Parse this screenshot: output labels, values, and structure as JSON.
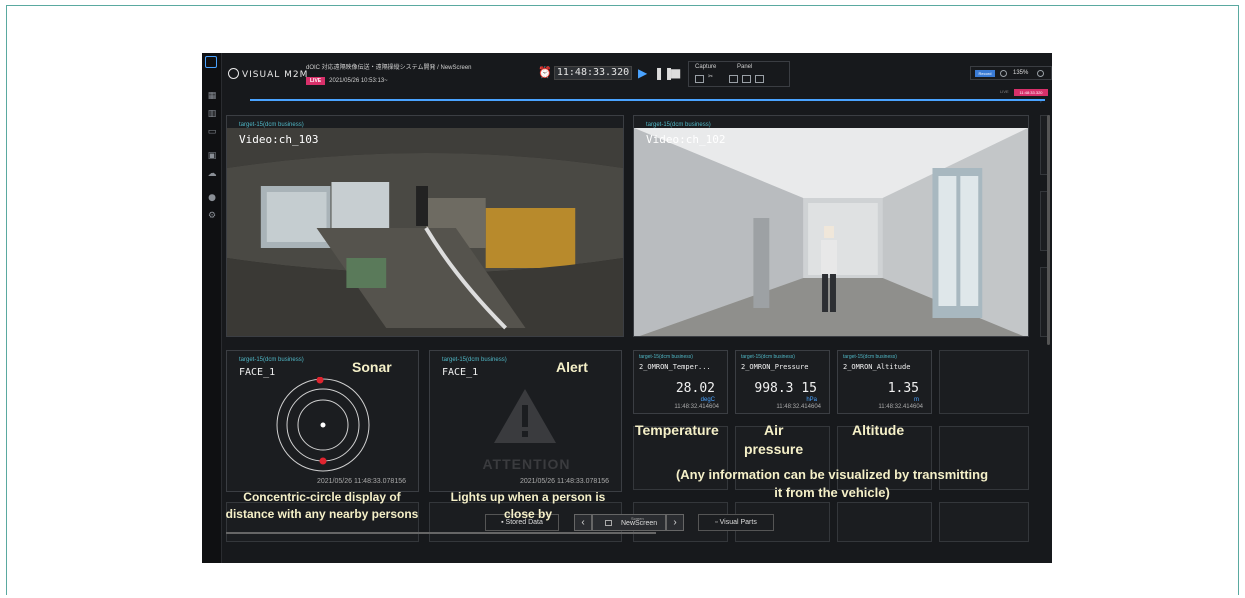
{
  "topbar": {
    "logo_text": "VISUAL M2M",
    "project_path": "dOIC 対応遠隔映像伝送・遠隔操縦システム開発 / NewScreen",
    "live_badge": "LIVE",
    "live_time": "2021/05/26 10:53:13~",
    "timecode": "11:48:33.320",
    "capture_label": "Capture",
    "panel_label": "Panel",
    "record_badge": "Record",
    "zoom": "135%",
    "timeline_badge": "11:48:33.320"
  },
  "videos": [
    {
      "target": "target-15(dcm business)",
      "title": "Video:ch_103"
    },
    {
      "target": "target-15(dcm business)",
      "title": "Video:ch_102"
    }
  ],
  "sonar_panel": {
    "target": "target-15(dcm business)",
    "title": "FACE_1",
    "timestamp": "2021/05/26 11:48:33.078156"
  },
  "alert_panel": {
    "target": "target-15(dcm business)",
    "title": "FACE_1",
    "attention": "ATTENTION",
    "timestamp": "2021/05/26 11:48:33.078156"
  },
  "sensors": [
    {
      "target": "target-15(dcm business)",
      "title": "2_OMRON_Temper...",
      "value": "28.02",
      "unit": "degC",
      "timestamp": "11:48:32.414604"
    },
    {
      "target": "target-15(dcm business)",
      "title": "2_OMRON_Pressure",
      "value": "998.3 15",
      "unit": "hPa",
      "timestamp": "11:48:32.414604"
    },
    {
      "target": "target-15(dcm business)",
      "title": "2_OMRON_Altitude",
      "value": "1.35",
      "unit": "m",
      "timestamp": "11:48:32.414604"
    }
  ],
  "bottombar": {
    "stored_data": "Stored Data",
    "screen_small": "Screen",
    "screen_name": "NewScreen",
    "visual_parts": "Visual Parts"
  },
  "annotations": {
    "sonar": "Sonar",
    "alert": "Alert",
    "temperature": "Temperature",
    "air": "Air",
    "pressure": "pressure",
    "altitude": "Altitude",
    "info_line1": "(Any information can be visualized by transmitting",
    "info_line2": "it from the vehicle)",
    "sonar_desc1": "Concentric-circle display of",
    "sonar_desc2": "distance with any nearby persons",
    "alert_desc1": "Lights up when a person is",
    "alert_desc2": "close by"
  },
  "colors": {
    "accent_blue": "#4aa3ff",
    "live_pink": "#d8306a",
    "target_teal": "#4fb6c4",
    "annotation_yellow": "#f5f0c8",
    "sonar_dot": "#e0242f"
  }
}
